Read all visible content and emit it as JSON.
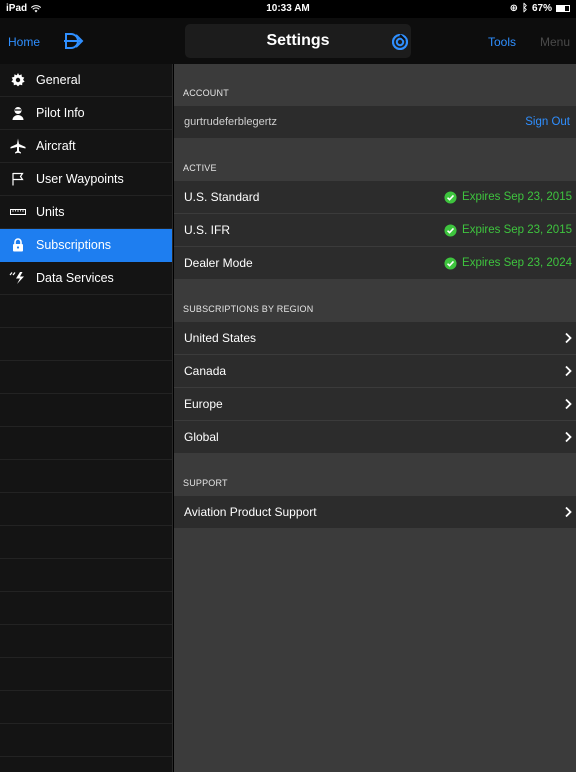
{
  "status_bar": {
    "device": "iPad",
    "time": "10:33 AM",
    "battery": "67%",
    "battery_level": 0.67
  },
  "nav": {
    "home_label": "Home",
    "title": "Settings",
    "tools_label": "Tools",
    "menu_label": "Menu"
  },
  "sidebar": {
    "items": [
      {
        "label": "General",
        "icon": "gear-icon"
      },
      {
        "label": "Pilot Info",
        "icon": "pilot-icon"
      },
      {
        "label": "Aircraft",
        "icon": "airplane-icon"
      },
      {
        "label": "User Waypoints",
        "icon": "flag-icon"
      },
      {
        "label": "Units",
        "icon": "ruler-icon"
      },
      {
        "label": "Subscriptions",
        "icon": "lock-icon",
        "active": true
      },
      {
        "label": "Data Services",
        "icon": "data-services-icon"
      }
    ]
  },
  "account": {
    "header": "ACCOUNT",
    "username": "gurtrudeferblegertz",
    "sign_out": "Sign Out"
  },
  "active": {
    "header": "ACTIVE",
    "rows": [
      {
        "label": "U.S. Standard",
        "status": "Expires Sep 23, 2015"
      },
      {
        "label": "U.S. IFR",
        "status": "Expires Sep 23, 2015"
      },
      {
        "label": "Dealer Mode",
        "status": "Expires Sep 23, 2024"
      }
    ]
  },
  "regions": {
    "header": "SUBSCRIPTIONS BY REGION",
    "rows": [
      {
        "label": "United States"
      },
      {
        "label": "Canada"
      },
      {
        "label": "Europe"
      },
      {
        "label": "Global"
      }
    ]
  },
  "support": {
    "header": "SUPPORT",
    "rows": [
      {
        "label": "Aviation Product Support"
      }
    ]
  },
  "colors": {
    "accent": "#1e7ef0",
    "link": "#2f8fff",
    "status_ok": "#3ec43e"
  }
}
